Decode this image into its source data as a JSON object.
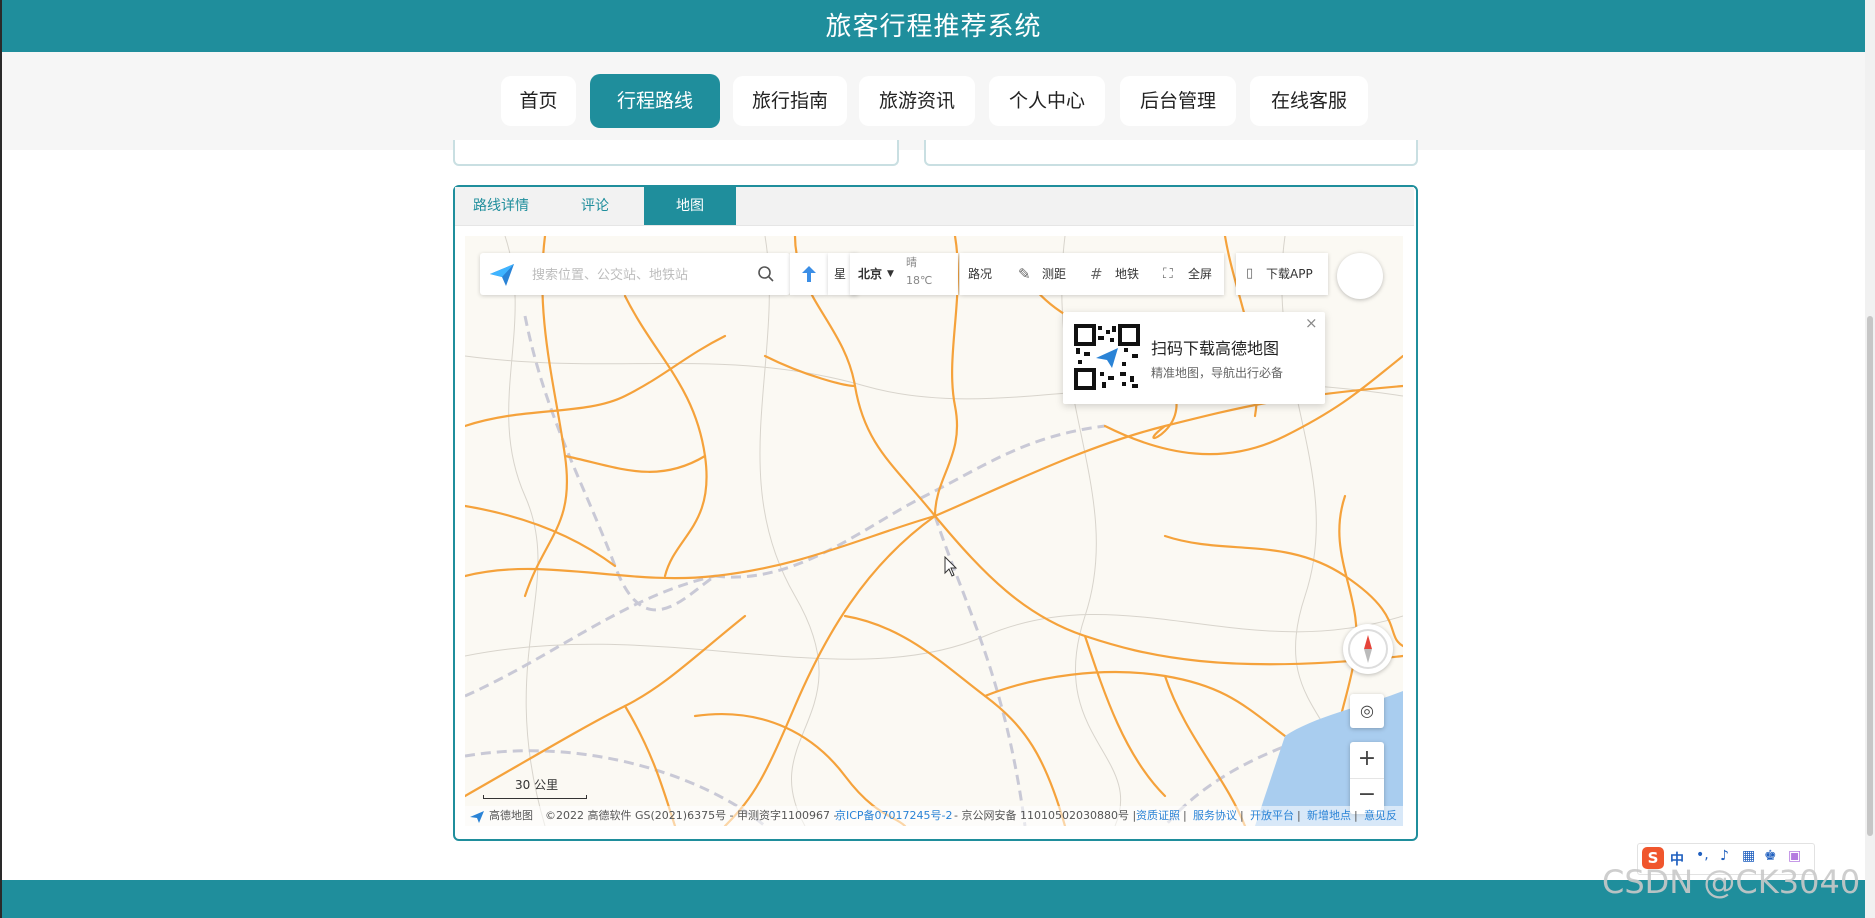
{
  "app": {
    "title": "旅客行程推荐系统"
  },
  "nav": {
    "items": [
      {
        "label": "首页"
      },
      {
        "label": "行程路线",
        "active": true
      },
      {
        "label": "旅行指南"
      },
      {
        "label": "旅游资讯"
      },
      {
        "label": "个人中心"
      },
      {
        "label": "后台管理"
      },
      {
        "label": "在线客服"
      }
    ]
  },
  "tabs": {
    "items": [
      {
        "label": "路线详情"
      },
      {
        "label": "评论"
      },
      {
        "label": "地图",
        "active": true
      }
    ]
  },
  "map": {
    "search_placeholder": "搜索位置、公交站、地铁站",
    "star_label": "星",
    "city": "北京",
    "weather": "晴",
    "temperature": "18℃",
    "traffic_label": "路况",
    "ruler_label": "测距",
    "subway_label": "地铁",
    "fullscreen_label": "全屏",
    "download_label": "下载APP",
    "qr_title": "扫码下载高德地图",
    "qr_subtitle": "精准地图，导航出行必备",
    "scale_label": "30 公里",
    "logo_text": "高德地图",
    "copyright": "©2022 高德软件 GS(2021)6375号 - 甲测资字1100967 -",
    "icp": "京ICP备07017245号-2",
    "police": "- 京公网安备 11010502030880号 |",
    "links": [
      "资质证照",
      "服务协议",
      "开放平台",
      "新增地点",
      "意见反"
    ],
    "zoom_in": "+",
    "zoom_out": "−"
  },
  "ime": {
    "label": "中"
  },
  "watermark": "CSDN @CK3040",
  "colors": {
    "primary": "#1f8e9c",
    "road": "#f5a23b",
    "rail": "#c9c9d6",
    "link": "#2a83d6"
  }
}
